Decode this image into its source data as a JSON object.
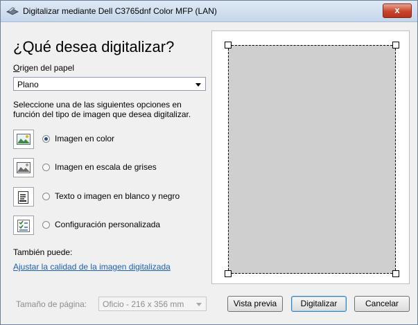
{
  "window": {
    "title": "Digitalizar mediante Dell C3765dnf Color MFP (LAN)",
    "close_label": "x"
  },
  "main": {
    "heading": "¿Qué desea digitalizar?",
    "paper_source_label": "Origen del papel",
    "paper_source_value": "Plano",
    "instructions": "Seleccione una de las siguientes opciones en función del tipo de imagen que desea digitalizar.",
    "options": [
      {
        "label": "Imagen en color",
        "icon": "color-photo-icon",
        "checked": true
      },
      {
        "label": "Imagen en escala de grises",
        "icon": "grayscale-photo-icon",
        "checked": false
      },
      {
        "label": "Texto o imagen en blanco y negro",
        "icon": "text-document-icon",
        "checked": false
      },
      {
        "label": "Configuración personalizada",
        "icon": "custom-settings-icon",
        "checked": false
      }
    ],
    "also_label": "También puede:",
    "adjust_link": "Ajustar la calidad de la imagen digitalizada"
  },
  "footer": {
    "page_size_label": "Tamaño de página:",
    "page_size_value": "Oficio - 216 x 356 mm",
    "preview_button": "Vista previa",
    "scan_button": "Digitalizar",
    "cancel_button": "Cancelar"
  },
  "colors": {
    "link": "#1a5fb4",
    "scan_area": "#cfcfcf",
    "close_button": "#c9452a"
  }
}
